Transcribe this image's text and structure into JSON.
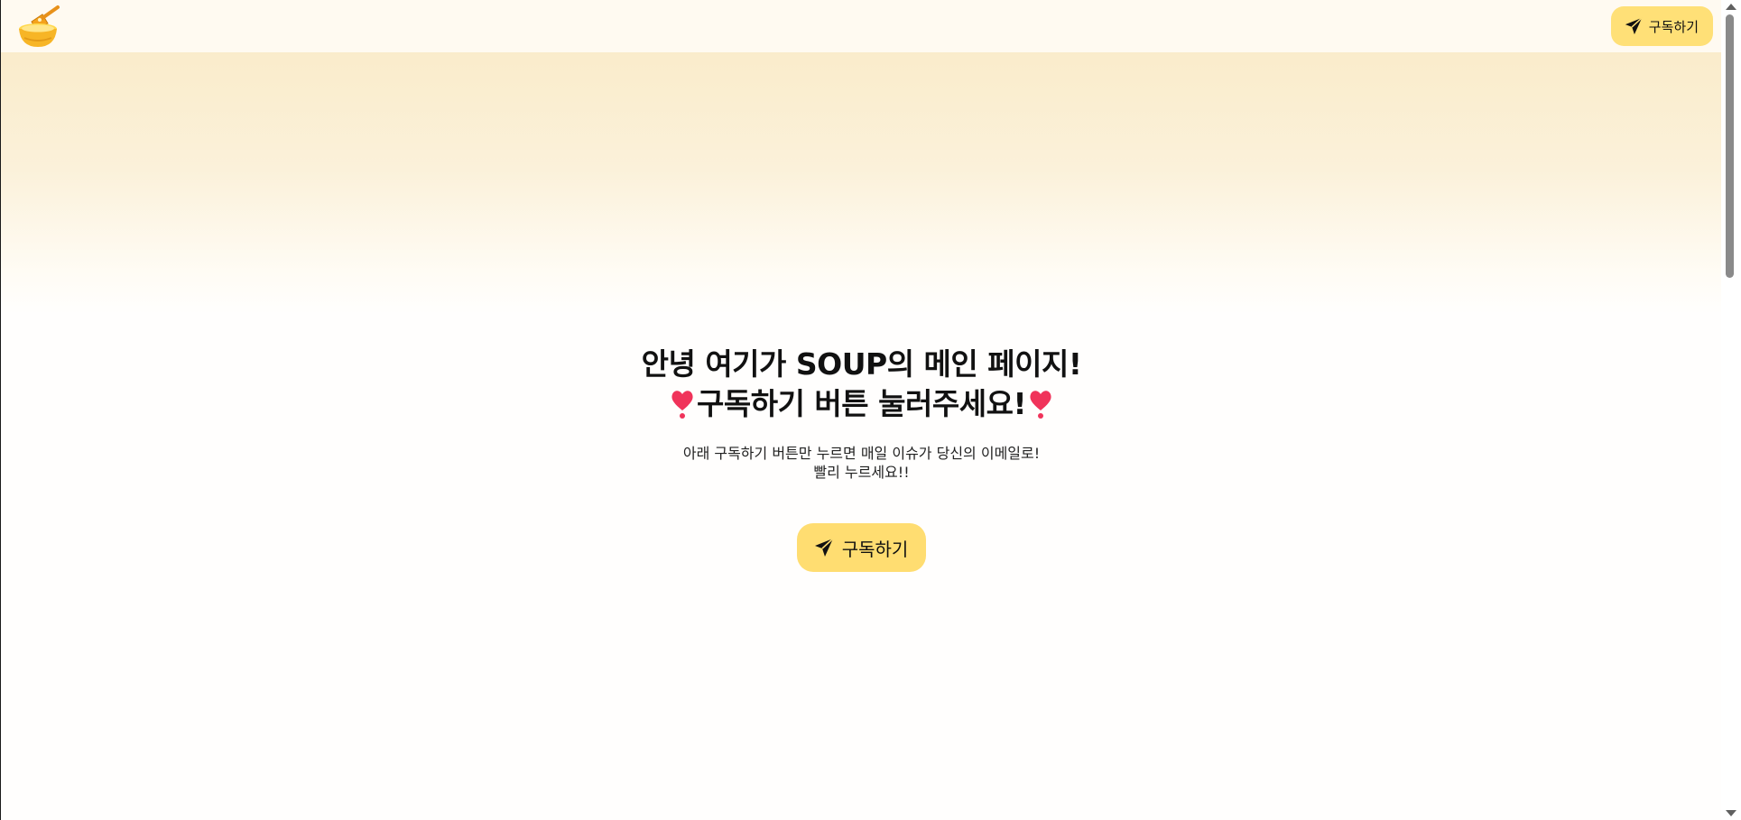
{
  "header": {
    "logo_icon": "soup-bowl-icon",
    "subscribe_label": "구독하기",
    "subscribe_icon": "paper-plane-icon"
  },
  "hero": {
    "title_line1": "안녕 여기가 SOUP의 메인 페이지!",
    "title_line2": "구독하기 버튼 눌러주세요!",
    "heart_icon": "heart-exclamation-icon",
    "desc_line1": "아래 구독하기 버튼만 누르면 매일 이슈가 당신의 이메일로!",
    "desc_line2": "빨리 누르세요!!",
    "cta_label": "구독하기",
    "cta_icon": "paper-plane-icon"
  },
  "colors": {
    "button_bg": "#ffdd71",
    "header_bg": "#fffaf1",
    "gradient_top": "#faeccb",
    "heart": "#f0335a"
  }
}
